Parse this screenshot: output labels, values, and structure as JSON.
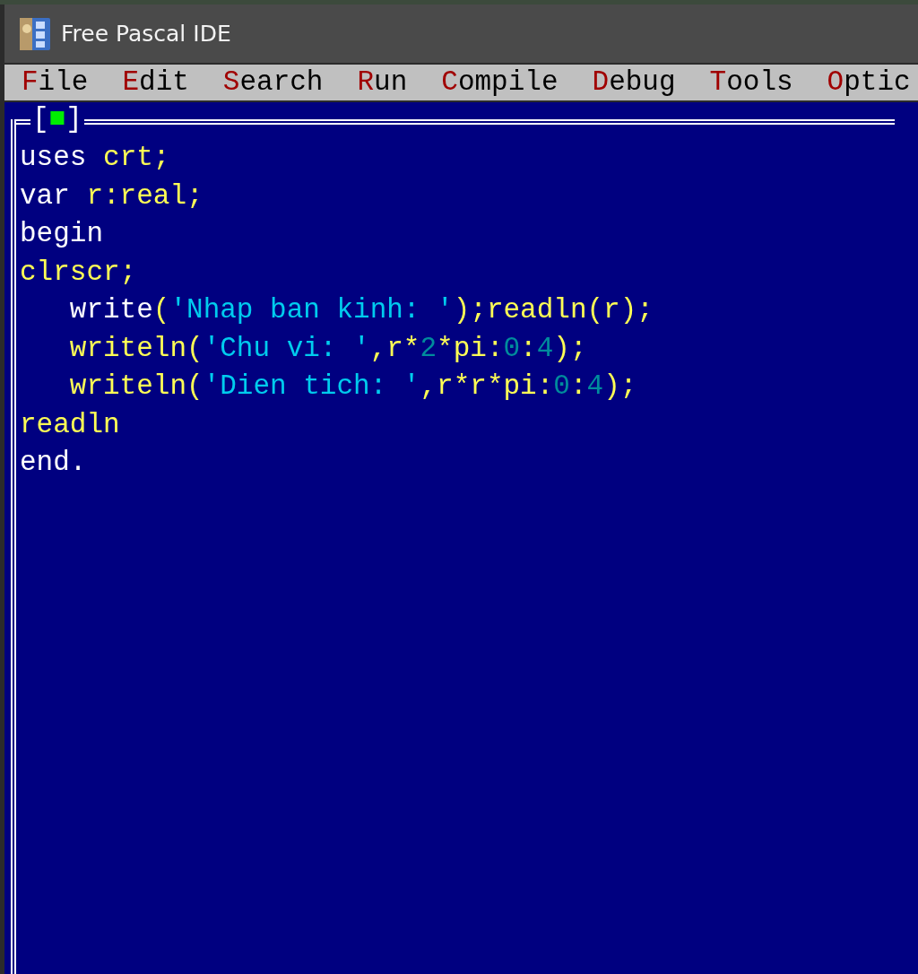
{
  "window": {
    "title": "Free Pascal IDE"
  },
  "menu": [
    {
      "label": "File"
    },
    {
      "label": "Edit"
    },
    {
      "label": "Search"
    },
    {
      "label": "Run"
    },
    {
      "label": "Compile"
    },
    {
      "label": "Debug"
    },
    {
      "label": "Tools"
    },
    {
      "label": "Optic"
    }
  ],
  "editor": {
    "close_box": "[■]",
    "lines": [
      {
        "indented": false,
        "tokens": [
          {
            "kind": "keyword",
            "text": "uses"
          },
          {
            "kind": "ident",
            "text": " crt;"
          }
        ]
      },
      {
        "indented": false,
        "tokens": [
          {
            "kind": "keyword",
            "text": "var"
          },
          {
            "kind": "ident",
            "text": " r:real;"
          }
        ]
      },
      {
        "indented": false,
        "tokens": [
          {
            "kind": "keyword",
            "text": "begin"
          }
        ]
      },
      {
        "indented": false,
        "tokens": [
          {
            "kind": "ident",
            "text": "clrscr;"
          }
        ]
      },
      {
        "indented": true,
        "tokens": [
          {
            "kind": "keyword",
            "text": "write"
          },
          {
            "kind": "ident",
            "text": "("
          },
          {
            "kind": "string",
            "text": "'Nhap ban kinh: '"
          },
          {
            "kind": "ident",
            "text": ");readln(r);"
          }
        ]
      },
      {
        "indented": true,
        "tokens": [
          {
            "kind": "ident",
            "text": "writeln("
          },
          {
            "kind": "string",
            "text": "'Chu vi: '"
          },
          {
            "kind": "ident",
            "text": ",r*"
          },
          {
            "kind": "number",
            "text": "2"
          },
          {
            "kind": "ident",
            "text": "*pi:"
          },
          {
            "kind": "number",
            "text": "0"
          },
          {
            "kind": "ident",
            "text": ":"
          },
          {
            "kind": "number",
            "text": "4"
          },
          {
            "kind": "ident",
            "text": ");"
          }
        ]
      },
      {
        "indented": true,
        "tokens": [
          {
            "kind": "ident",
            "text": "writeln("
          },
          {
            "kind": "string",
            "text": "'Dien tich: '"
          },
          {
            "kind": "ident",
            "text": ",r*r*pi:"
          },
          {
            "kind": "number",
            "text": "0"
          },
          {
            "kind": "ident",
            "text": ":"
          },
          {
            "kind": "number",
            "text": "4"
          },
          {
            "kind": "ident",
            "text": ");"
          }
        ]
      },
      {
        "indented": false,
        "tokens": [
          {
            "kind": "ident",
            "text": "readln"
          }
        ]
      },
      {
        "indented": false,
        "tokens": [
          {
            "kind": "keyword",
            "text": "end."
          }
        ]
      }
    ]
  }
}
